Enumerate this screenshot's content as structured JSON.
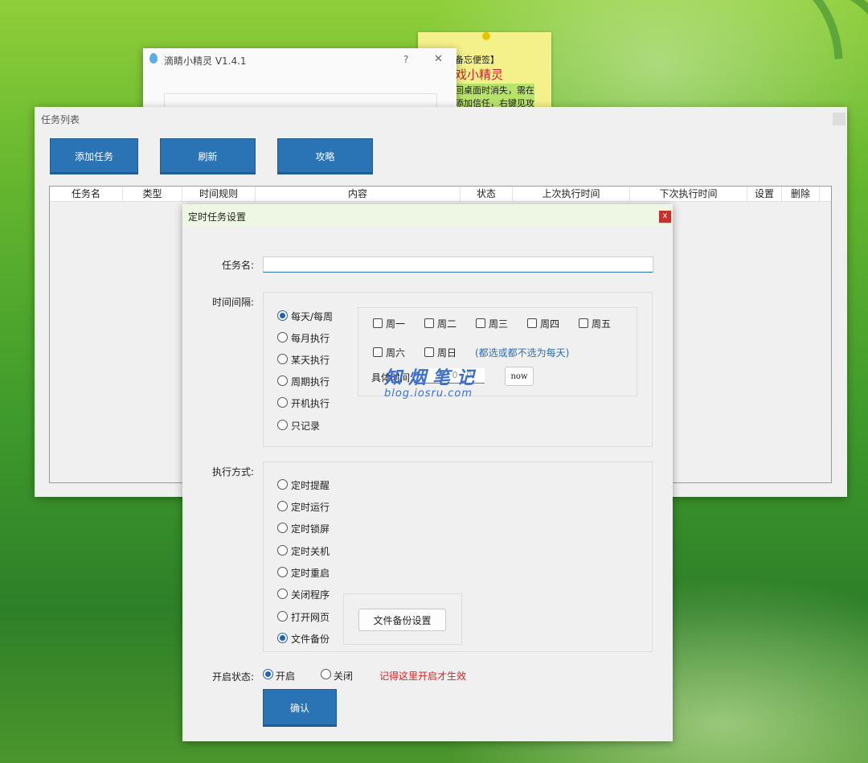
{
  "note": {
    "line1": "备忘便签】",
    "line2": "戏小精灵",
    "line3": "回桌面时消失，需在",
    "line4": "添加信任，右键见攻"
  },
  "app_window": {
    "title": "滴睛小精灵 V1.4.1",
    "help": "?",
    "close": "✕"
  },
  "task_list": {
    "title": "任务列表",
    "buttons": {
      "add": "添加任务",
      "refresh": "刷新",
      "guide": "攻略"
    },
    "columns": [
      "任务名",
      "类型",
      "时间规则",
      "内容",
      "状态",
      "上次执行时间",
      "下次执行时间",
      "设置",
      "删除"
    ]
  },
  "dialog": {
    "title": "定时任务设置",
    "close": "x",
    "task_name_label": "任务名:",
    "task_name_value": "",
    "interval_label": "时间间隔:",
    "interval_options": [
      "每天/每周",
      "每月执行",
      "某天执行",
      "周期执行",
      "开机执行",
      "只记录"
    ],
    "interval_selected": "每天/每周",
    "weekdays_row1": [
      "周一",
      "周二",
      "周三",
      "周四",
      "周五"
    ],
    "weekdays_row2": [
      "周六",
      "周日"
    ],
    "weekday_hint": "(都选或都不选为每天)",
    "time_label": "具体时间:",
    "time_value": "0 : 0 : 0",
    "now_button": "now",
    "exec_label": "执行方式:",
    "exec_options": [
      "定时提醒",
      "定时运行",
      "定时锁屏",
      "定时关机",
      "定时重启",
      "关闭程序",
      "打开网页",
      "文件备份"
    ],
    "exec_selected": "文件备份",
    "backup_button": "文件备份设置",
    "enable_label": "开启状态:",
    "enable_on": "开启",
    "enable_off": "关闭",
    "enable_hint": "记得这里开启才生效",
    "confirm": "确认"
  },
  "watermark": {
    "title": "知烟笔记",
    "url": "blog.iosru.com"
  },
  "colors": {
    "accent": "#2a73b5",
    "hint_blue": "#2a6fb0",
    "hint_red": "#e02020"
  }
}
